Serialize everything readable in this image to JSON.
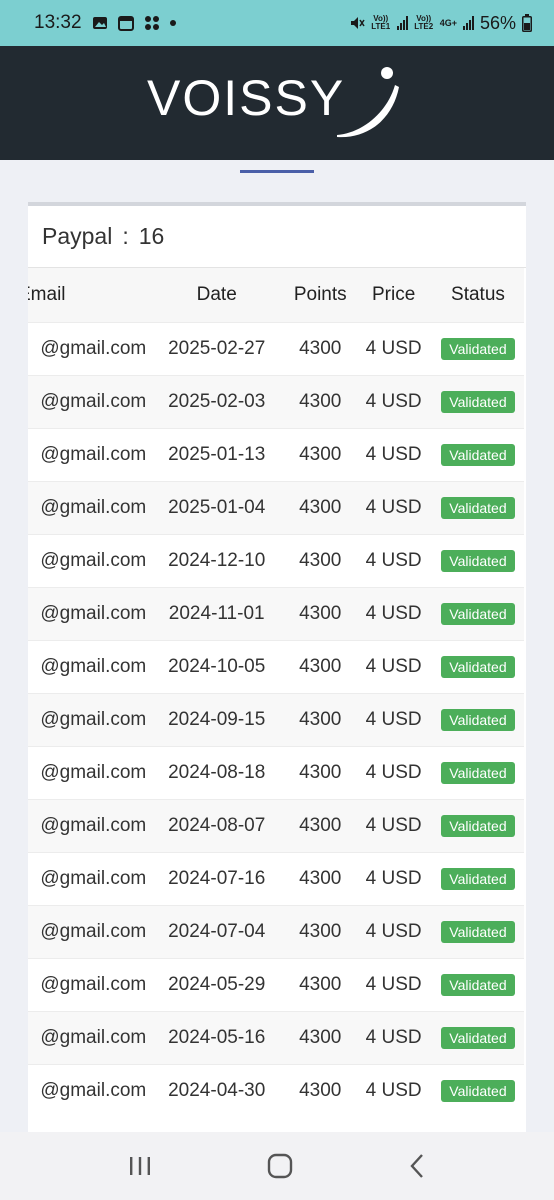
{
  "status_bar": {
    "time": "13:32",
    "network_1": "Vo)) LTE1",
    "network_2": "Vo)) LTE2",
    "network_type": "4G+",
    "battery": "56%"
  },
  "header": {
    "logo_text": "VOISSY"
  },
  "card": {
    "title_label": "Paypal",
    "title_separator": ":",
    "title_count": "16"
  },
  "table": {
    "headers": [
      "Email",
      "Date",
      "Points",
      "Price",
      "Status"
    ],
    "rows": [
      {
        "email": "@gmail.com",
        "date": "2025-02-27",
        "points": "4300",
        "price": "4 USD",
        "status": "Validated"
      },
      {
        "email": "@gmail.com",
        "date": "2025-02-03",
        "points": "4300",
        "price": "4 USD",
        "status": "Validated"
      },
      {
        "email": "@gmail.com",
        "date": "2025-01-13",
        "points": "4300",
        "price": "4 USD",
        "status": "Validated"
      },
      {
        "email": "@gmail.com",
        "date": "2025-01-04",
        "points": "4300",
        "price": "4 USD",
        "status": "Validated"
      },
      {
        "email": "@gmail.com",
        "date": "2024-12-10",
        "points": "4300",
        "price": "4 USD",
        "status": "Validated"
      },
      {
        "email": "@gmail.com",
        "date": "2024-11-01",
        "points": "4300",
        "price": "4 USD",
        "status": "Validated"
      },
      {
        "email": "@gmail.com",
        "date": "2024-10-05",
        "points": "4300",
        "price": "4 USD",
        "status": "Validated"
      },
      {
        "email": "@gmail.com",
        "date": "2024-09-15",
        "points": "4300",
        "price": "4 USD",
        "status": "Validated"
      },
      {
        "email": "@gmail.com",
        "date": "2024-08-18",
        "points": "4300",
        "price": "4 USD",
        "status": "Validated"
      },
      {
        "email": "@gmail.com",
        "date": "2024-08-07",
        "points": "4300",
        "price": "4 USD",
        "status": "Validated"
      },
      {
        "email": "@gmail.com",
        "date": "2024-07-16",
        "points": "4300",
        "price": "4 USD",
        "status": "Validated"
      },
      {
        "email": "@gmail.com",
        "date": "2024-07-04",
        "points": "4300",
        "price": "4 USD",
        "status": "Validated"
      },
      {
        "email": "@gmail.com",
        "date": "2024-05-29",
        "points": "4300",
        "price": "4 USD",
        "status": "Validated"
      },
      {
        "email": "@gmail.com",
        "date": "2024-05-16",
        "points": "4300",
        "price": "4 USD",
        "status": "Validated"
      },
      {
        "email": "@gmail.com",
        "date": "2024-04-30",
        "points": "4300",
        "price": "4 USD",
        "status": "Validated"
      }
    ]
  },
  "colors": {
    "status_bar_bg": "#7ccfd0",
    "header_bg": "#222a31",
    "badge_green": "#4cae5a",
    "accent_blue": "#4a5fa8"
  },
  "nav": {
    "icons": [
      "recent-apps-icon",
      "home-icon",
      "back-icon"
    ]
  }
}
